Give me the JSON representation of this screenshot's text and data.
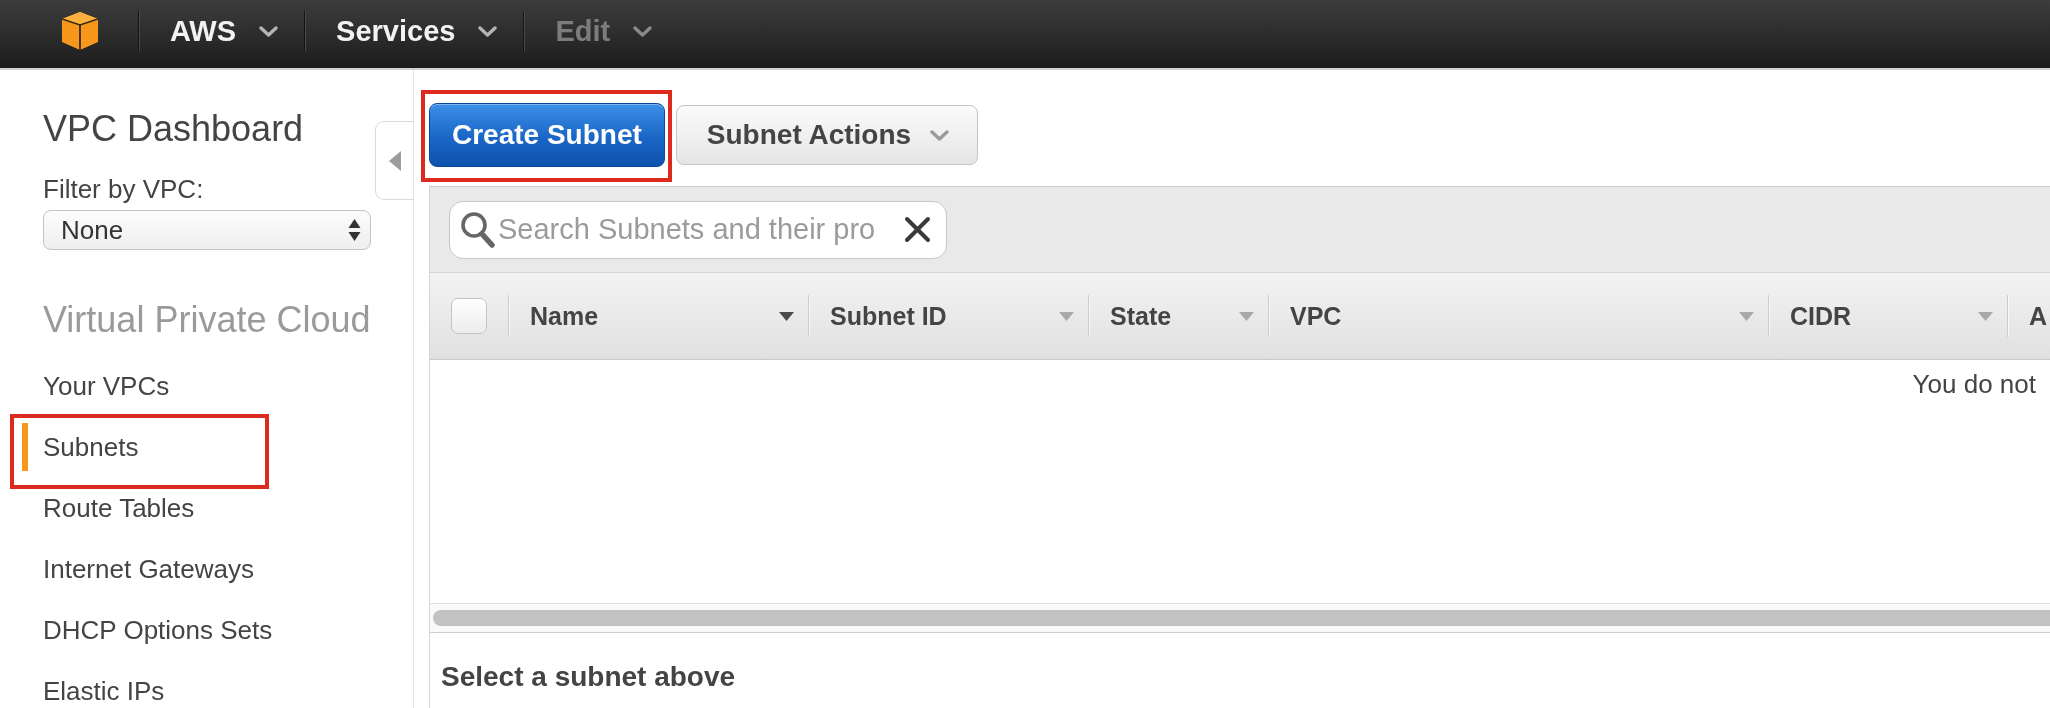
{
  "top_nav": {
    "items": [
      {
        "label": "AWS",
        "disabled": false
      },
      {
        "label": "Services",
        "disabled": false
      },
      {
        "label": "Edit",
        "disabled": true
      }
    ]
  },
  "sidebar": {
    "title": "VPC Dashboard",
    "filter": {
      "label": "Filter by VPC:",
      "value": "None"
    },
    "section": "Virtual Private Cloud",
    "items": [
      {
        "label": "Your VPCs",
        "selected": false,
        "highlighted": false
      },
      {
        "label": "Subnets",
        "selected": true,
        "highlighted": true
      },
      {
        "label": "Route Tables",
        "selected": false,
        "highlighted": false
      },
      {
        "label": "Internet Gateways",
        "selected": false,
        "highlighted": false
      },
      {
        "label": "DHCP Options Sets",
        "selected": false,
        "highlighted": false
      },
      {
        "label": "Elastic IPs",
        "selected": false,
        "highlighted": false
      }
    ]
  },
  "toolbar": {
    "buttons": [
      {
        "label": "Create Subnet",
        "kind": "primary",
        "highlighted": true
      },
      {
        "label": "Subnet Actions",
        "kind": "dropdown",
        "highlighted": false
      }
    ]
  },
  "search": {
    "placeholder": "Search Subnets and their pro"
  },
  "table": {
    "select_all": {
      "checked": false
    },
    "columns": [
      {
        "label": "Name",
        "sorted": true
      },
      {
        "label": "Subnet ID",
        "sorted": false
      },
      {
        "label": "State",
        "sorted": false
      },
      {
        "label": "VPC",
        "sorted": false
      },
      {
        "label": "CIDR",
        "sorted": false
      },
      {
        "label": "A"
      }
    ],
    "empty_message": "You do not"
  },
  "details": {
    "message": "Select a subnet above"
  }
}
